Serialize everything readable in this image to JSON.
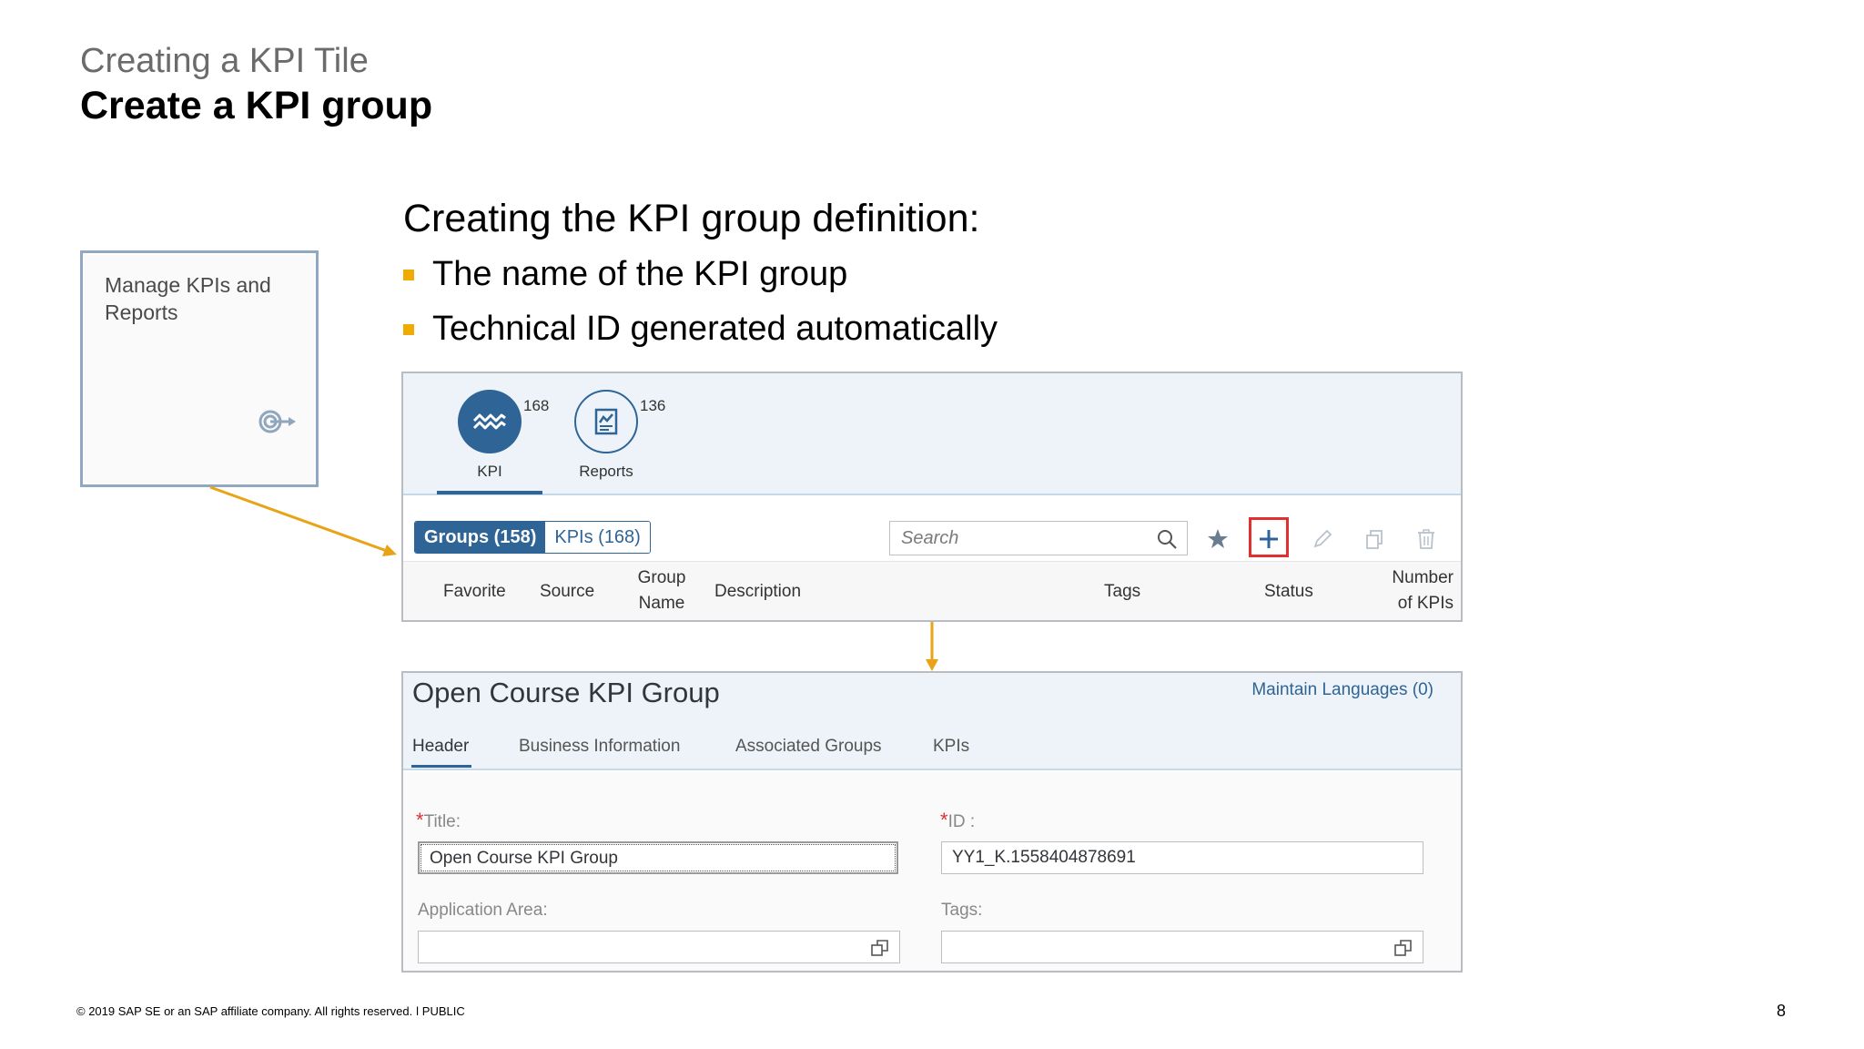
{
  "slide": {
    "supertitle": "Creating a KPI Tile",
    "title": "Create a KPI group",
    "heading": "Creating the KPI group definition:",
    "bullets": [
      "The name of the KPI group",
      "Technical ID generated automatically"
    ]
  },
  "tile": {
    "title": "Manage KPIs and Reports",
    "icon": "target-arrow-icon"
  },
  "list_view": {
    "icon_tabs": [
      {
        "label": "KPI",
        "count": "168",
        "icon": "kpi-trend-icon",
        "selected": true
      },
      {
        "label": "Reports",
        "count": "136",
        "icon": "report-document-icon",
        "selected": false
      }
    ],
    "segments": [
      {
        "label": "Groups (158)",
        "selected": true
      },
      {
        "label": "KPIs (168)",
        "selected": false
      }
    ],
    "search_placeholder": "Search",
    "toolbar_icons": [
      "star-icon",
      "add-icon",
      "pencil-icon",
      "copy-icon",
      "trash-icon"
    ],
    "columns": {
      "favorite": "Favorite",
      "source": "Source",
      "group_name_1": "Group",
      "group_name_2": "Name",
      "description": "Description",
      "tags": "Tags",
      "status": "Status",
      "num_kpis_1": "Number",
      "num_kpis_2": "of KPIs"
    }
  },
  "detail_view": {
    "title": "Open Course KPI Group",
    "maintain_languages": "Maintain Languages (0)",
    "tabs": [
      "Header",
      "Business Information",
      "Associated Groups",
      "KPIs"
    ],
    "fields": {
      "title_label": "Title:",
      "title_value": "Open Course KPI Group",
      "id_label": "ID :",
      "id_value": "YY1_K.1558404878691",
      "app_area_label": "Application Area:",
      "tags_label": "Tags:",
      "required_marker": "*"
    }
  },
  "colors": {
    "accent": "#2f6497",
    "bullet": "#f0ab00",
    "arrow": "#e8a317",
    "highlight": "#e0302f"
  },
  "footer": {
    "copyright": "© 2019 SAP SE or an SAP affiliate company. All rights reserved.   ǀ   PUBLIC",
    "page": "8"
  }
}
